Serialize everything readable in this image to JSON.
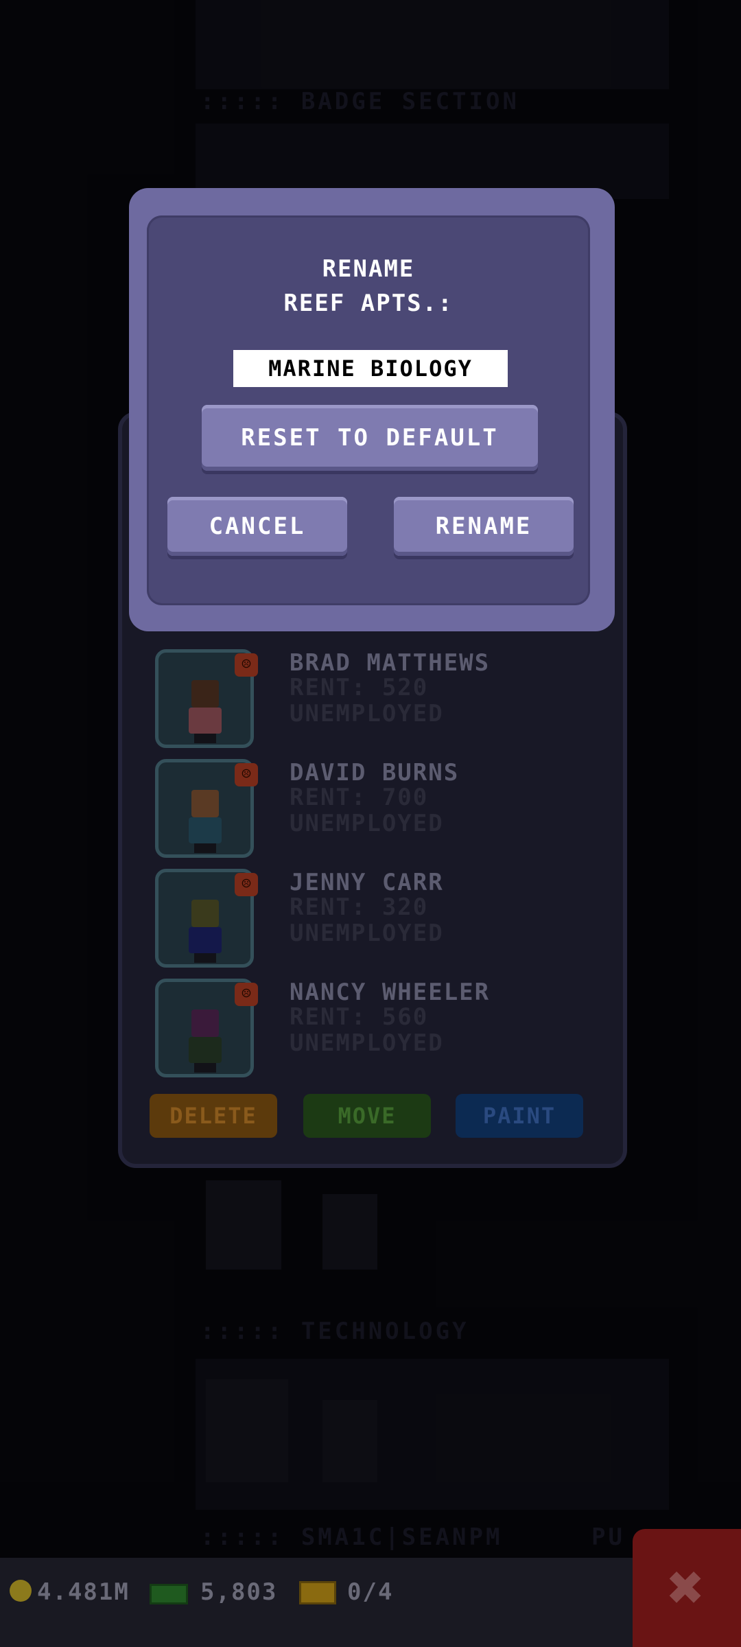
{
  "background": {
    "section_labels": [
      "::::: BADGE SECTION",
      "::::: TECHNOLOGY",
      "::::: SMA1C|SEANPM",
      "PU"
    ]
  },
  "dialog": {
    "title_line1": "RENAME",
    "title_line2": "REEF APTS.:",
    "name_value": "MARINE BIOLOGY",
    "reset_label": "RESET TO DEFAULT",
    "cancel_label": "CANCEL",
    "rename_label": "RENAME"
  },
  "residents": [
    {
      "name": "BRAD MATTHEWS",
      "rent": "RENT: 520",
      "job": "UNEMPLOYED",
      "mood_icon": "sad-face-icon"
    },
    {
      "name": "DAVID BURNS",
      "rent": "RENT: 700",
      "job": "UNEMPLOYED",
      "mood_icon": "sad-face-icon"
    },
    {
      "name": "JENNY CARR",
      "rent": "RENT: 320",
      "job": "UNEMPLOYED",
      "mood_icon": "sad-face-icon"
    },
    {
      "name": "NANCY WHEELER",
      "rent": "RENT: 560",
      "job": "UNEMPLOYED",
      "mood_icon": "sad-face-icon"
    }
  ],
  "actions": {
    "delete_label": "DELETE",
    "move_label": "MOVE",
    "paint_label": "PAINT"
  },
  "status_bar": {
    "coins": "4.481M",
    "bux": "5,803",
    "tickets": "0/4"
  },
  "colors": {
    "dialog_outer": "#6e6aa0",
    "dialog_inner": "#4b4875",
    "button": "#7f7bb0",
    "delete": "#5c3a0c",
    "move": "#1c3a14",
    "paint": "#0c2a52",
    "close": "#6a1414"
  }
}
